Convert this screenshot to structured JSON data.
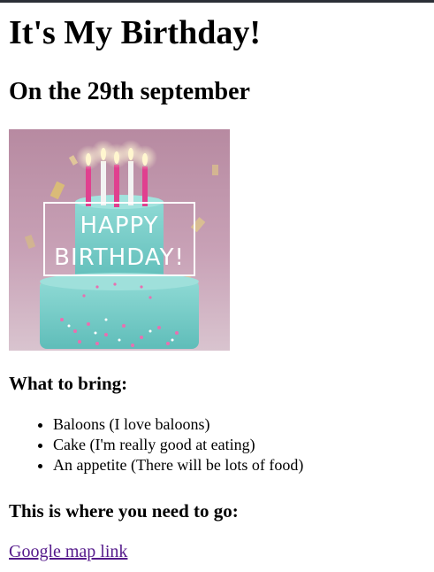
{
  "page": {
    "title": "It's My Birthday!",
    "date_heading": "On the 29th september",
    "image": {
      "line1": "HAPPY",
      "line2": "BIRTHDAY!"
    },
    "bring_heading": "What to bring:",
    "bring_items": [
      "Baloons (I love baloons)",
      "Cake (I'm really good at eating)",
      "An appetite (There will be lots of food)"
    ],
    "location_heading": "This is where you need to go:",
    "map_link": "Google map link"
  },
  "colors": {
    "link_visited": "#551a8b",
    "topbar": "#2b2f36",
    "cake_teal": "#7fd3cf",
    "background_pink": "#c9a0b4"
  }
}
